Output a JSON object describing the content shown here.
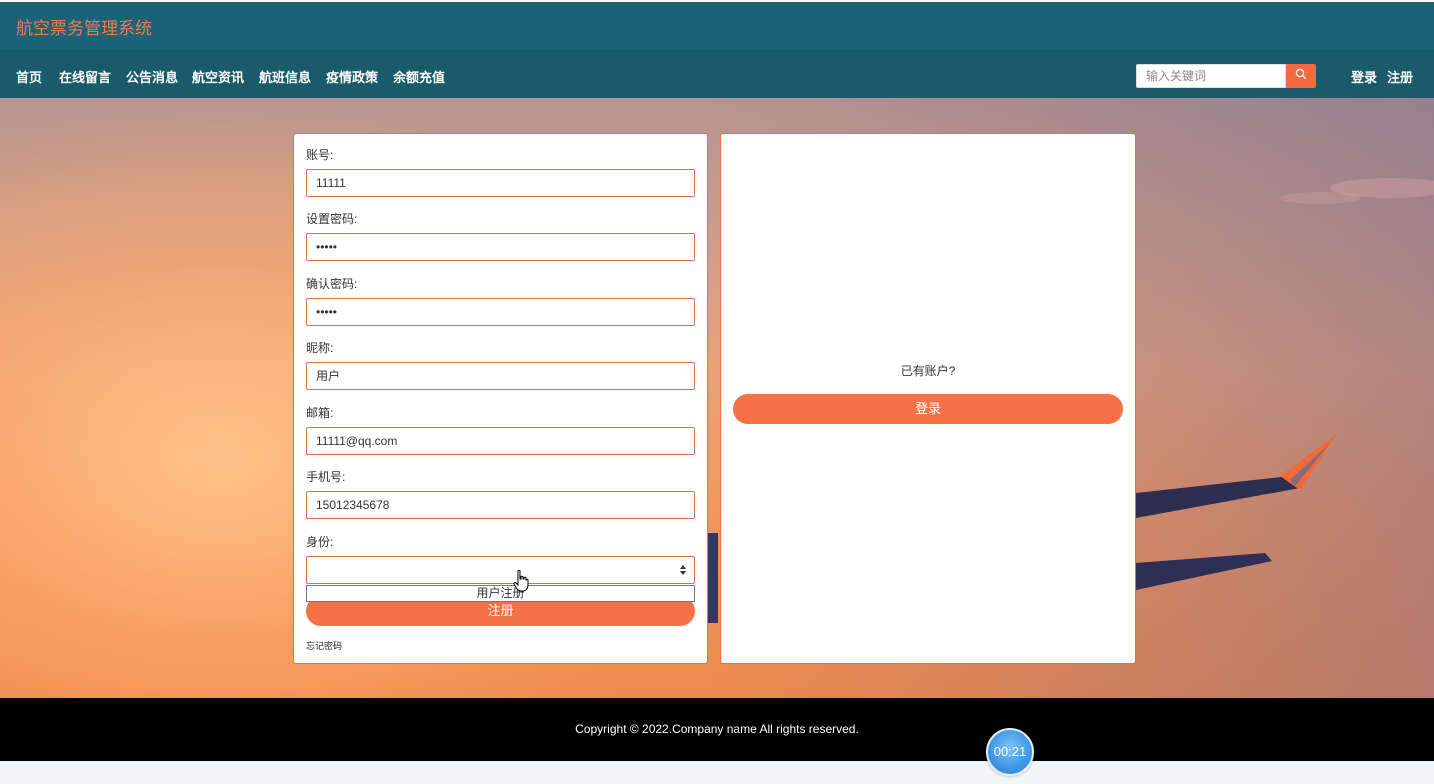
{
  "header": {
    "site_title": "航空票务管理系统"
  },
  "nav": {
    "items": [
      {
        "label": "首页"
      },
      {
        "label": "在线留言"
      },
      {
        "label": "公告消息"
      },
      {
        "label": "航空资讯"
      },
      {
        "label": "航班信息"
      },
      {
        "label": "疫情政策"
      },
      {
        "label": "余额充值"
      }
    ],
    "search_placeholder": "输入关键词",
    "login_label": "登录",
    "register_label": "注册"
  },
  "register_form": {
    "account_label": "账号:",
    "account_value": "11111",
    "password_label": "设置密码:",
    "password_value": "•••••",
    "confirm_label": "确认密码:",
    "confirm_value": "•••••",
    "nickname_label": "昵称:",
    "nickname_value": "用户",
    "email_label": "邮箱:",
    "email_value": "11111@qq.com",
    "phone_label": "手机号:",
    "phone_value": "15012345678",
    "role_label": "身份:",
    "role_value": "",
    "role_options": [
      "用户注册"
    ],
    "submit_label": "注册",
    "forgot_label": "忘记密码"
  },
  "login_panel": {
    "prompt": "已有账户?",
    "login_button": "登录"
  },
  "footer": {
    "copyright": "Copyright © 2022.Company name All rights reserved."
  },
  "timer": {
    "value": "00:21"
  },
  "colors": {
    "topbar": "#1b6377",
    "navbar": "#195a6b",
    "accent": "#f77146",
    "footer": "#000000"
  }
}
